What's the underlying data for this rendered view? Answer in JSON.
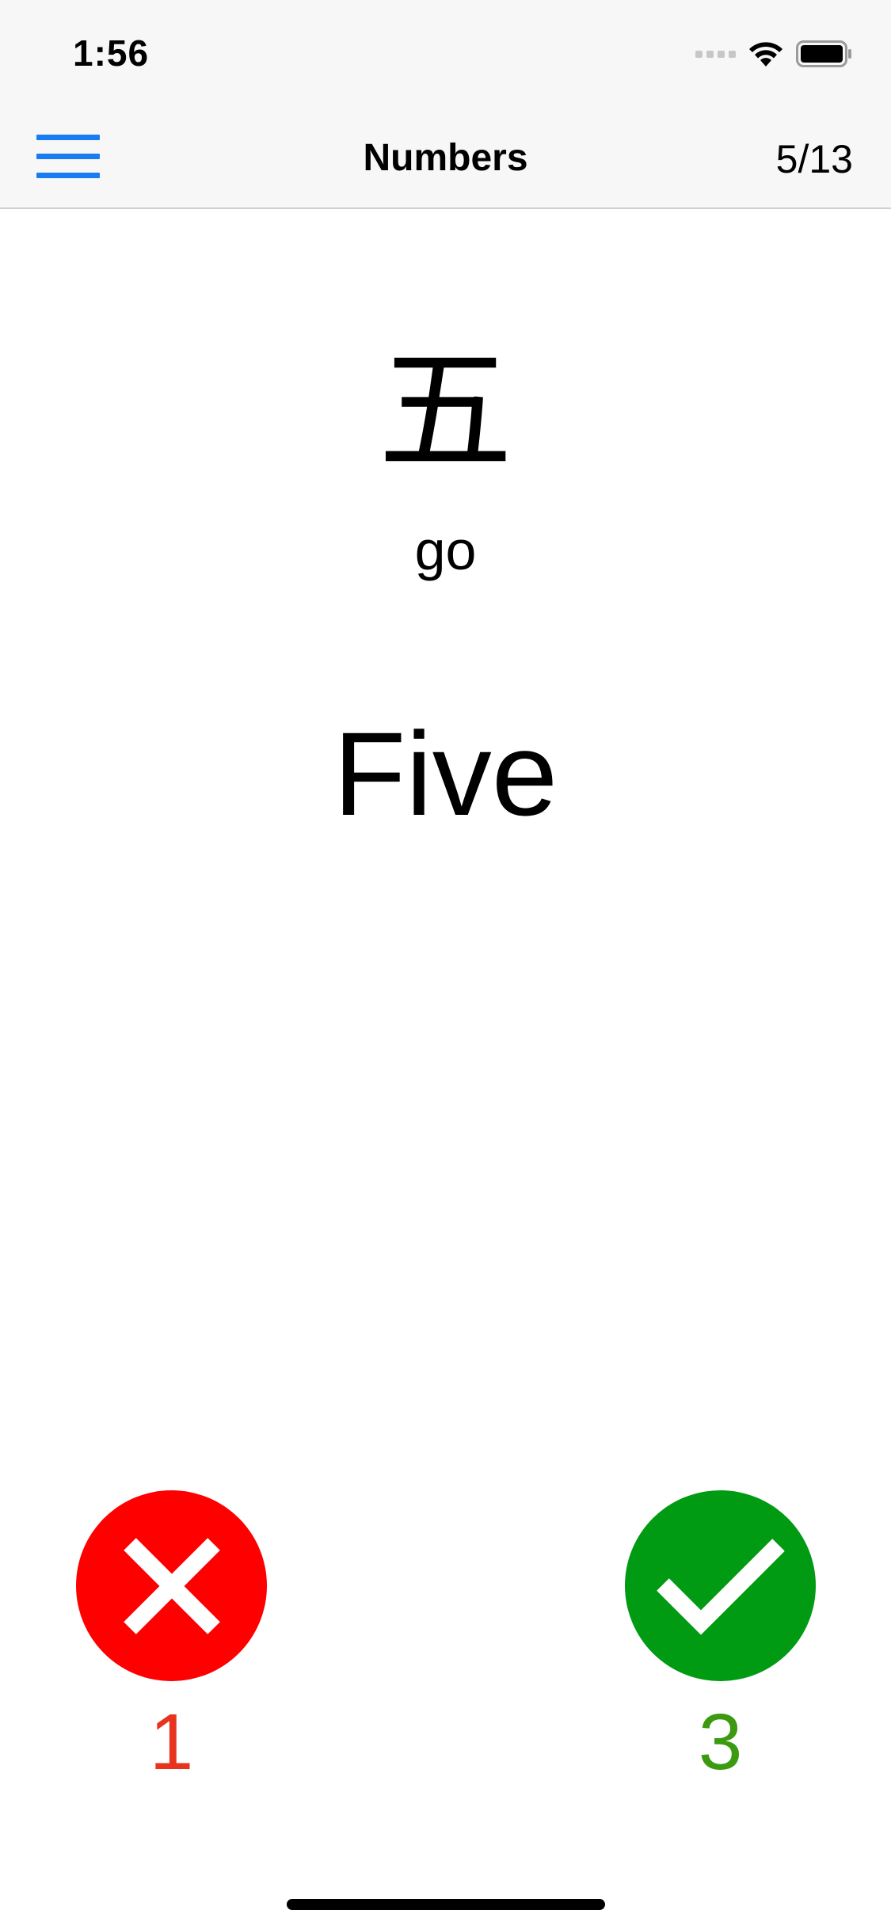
{
  "status_bar": {
    "time": "1:56"
  },
  "nav": {
    "title": "Numbers",
    "counter": "5/13",
    "accent_color": "#1a7cf2",
    "menu_icon": "hamburger-menu-icon"
  },
  "card": {
    "kanji": "五",
    "reading": "go",
    "meaning": "Five"
  },
  "answers": {
    "wrong": {
      "icon": "x-mark-icon",
      "color": "#ff0000",
      "count": "1",
      "count_color": "#e8331e"
    },
    "right": {
      "icon": "checkmark-icon",
      "color": "#009b12",
      "count": "3",
      "count_color": "#3b9a10"
    }
  }
}
